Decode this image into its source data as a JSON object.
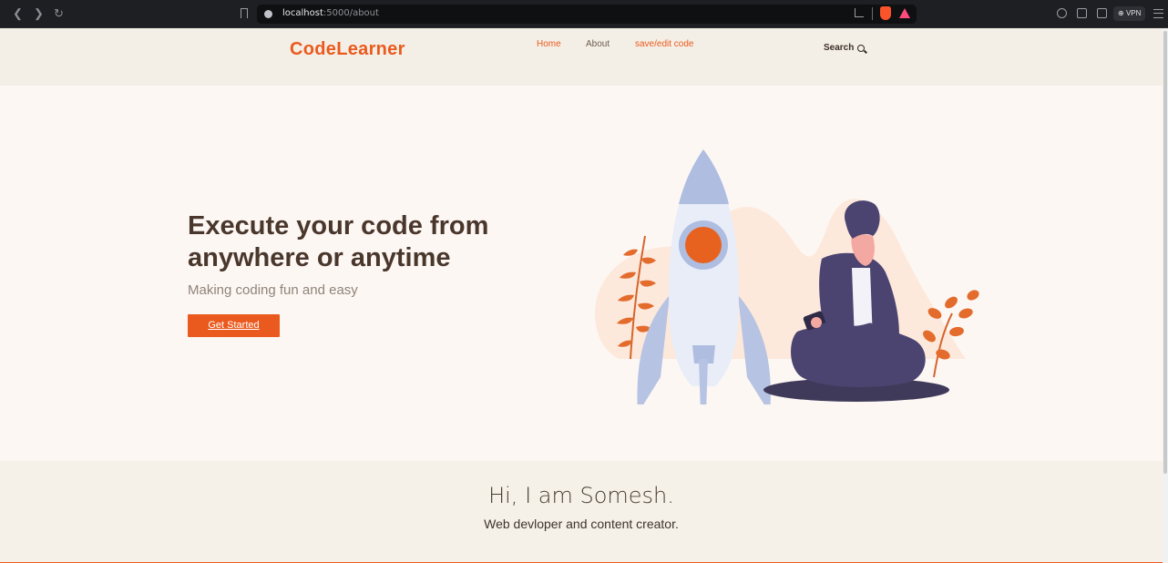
{
  "browser": {
    "url_host": "localhost",
    "url_path": ":5000/about",
    "vpn_label": "VPN"
  },
  "header": {
    "logo": "CodeLearner",
    "nav": [
      {
        "label": "Home",
        "active": true
      },
      {
        "label": "About",
        "active": false
      },
      {
        "label": "save/edit code",
        "active": false
      }
    ],
    "search_label": "Search"
  },
  "hero": {
    "title": "Execute your code from anywhere or anytime",
    "subtitle": "Making coding fun and easy",
    "cta": "Get Started"
  },
  "about": {
    "title": "Hi, I am Somesh.",
    "subtitle": "Web devloper and content creator."
  },
  "colors": {
    "accent": "#ea5a1e",
    "hero_bg": "#fdf7f4",
    "header_bg": "#f4efe6"
  }
}
